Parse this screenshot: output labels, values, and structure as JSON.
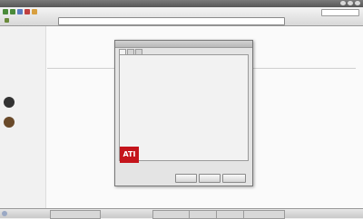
{
  "window": {
    "title": ""
  },
  "toolbar": {
    "menu": [
      "",
      "",
      "",
      ""
    ],
    "url": ""
  },
  "bookmarks": [
    "",
    "",
    "",
    ""
  ],
  "sidebar": {
    "items": [
      "",
      "",
      "",
      "",
      ""
    ]
  },
  "content": {
    "lines": [
      "",
      "",
      "",
      "",
      "",
      "",
      "",
      "",
      "",
      "",
      "",
      ""
    ],
    "link_labels": [
      "",
      "",
      "",
      ""
    ]
  },
  "dialog": {
    "tabs": [
      "",
      "",
      ""
    ],
    "rows": [
      {
        "label": "",
        "value": ""
      },
      {
        "label": "",
        "value": ""
      },
      {
        "label": "",
        "value": ""
      },
      {
        "label": "",
        "value": ""
      },
      {
        "label": "",
        "value": ""
      },
      {
        "label": "",
        "value": ""
      },
      {
        "label": "",
        "value": ""
      },
      {
        "label": "",
        "value": ""
      }
    ],
    "logo_text": "ATI",
    "buttons": [
      "",
      "",
      ""
    ]
  },
  "taskbar": {
    "tasks": [
      "",
      "",
      "",
      "",
      ""
    ],
    "clock": ""
  },
  "colors": {
    "ati_red": "#c4141b",
    "link": "#2a4aa8"
  }
}
